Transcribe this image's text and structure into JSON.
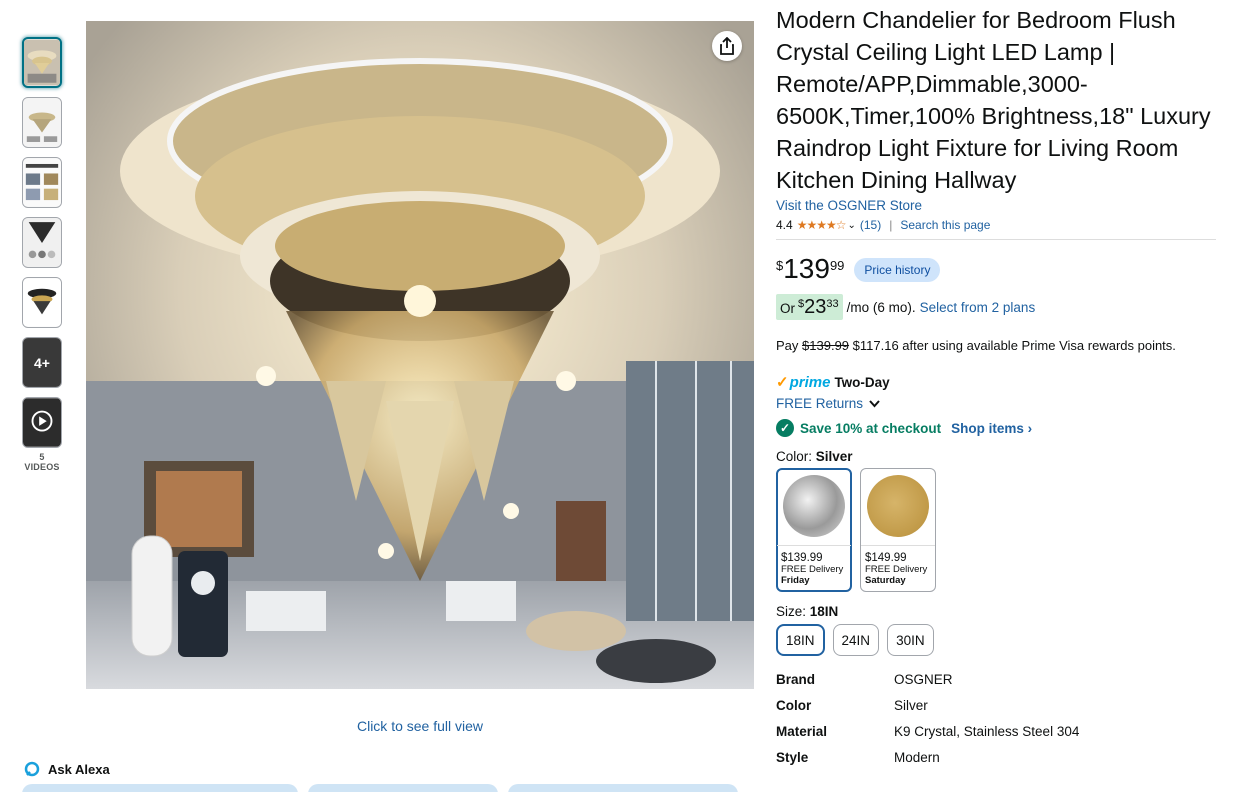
{
  "thumbnails": {
    "items": [
      {
        "name": "thumb-chandelier-main",
        "selected": true
      },
      {
        "name": "thumb-dimensions"
      },
      {
        "name": "thumb-features"
      },
      {
        "name": "thumb-crystal-detail"
      },
      {
        "name": "thumb-chandelier-dark"
      },
      {
        "name": "thumb-more",
        "overlay": "4+"
      },
      {
        "name": "thumb-video"
      }
    ],
    "videos_label": "5 VIDEOS"
  },
  "main_image": {
    "click_full_view": "Click to see full view"
  },
  "alexa": {
    "label": "Ask Alexa"
  },
  "product": {
    "title": "Modern Chandelier for Bedroom Flush Crystal Ceiling Light LED Lamp | Remote/APP,Dimmable,3000-6500K,Timer,100% Brightness,18\" Luxury Raindrop Light Fixture for Living Room Kitchen Dining Hallway",
    "store_link": "Visit the OSGNER Store",
    "rating": "4.4",
    "stars": "★★★★☆",
    "review_count": "(15)",
    "separator": "|",
    "search_page": "Search this page"
  },
  "price": {
    "symbol": "$",
    "whole": "139",
    "fraction": "99",
    "history_label": "Price history"
  },
  "monthly": {
    "or": "Or",
    "symbol": "$",
    "whole": "23",
    "fraction": "33",
    "per": "/mo (6 mo).",
    "select_plans": "Select from 2 plans"
  },
  "prime_offer": {
    "pay": "Pay",
    "old_price": "$139.99",
    "rest": "$117.16 after using available Prime Visa rewards points."
  },
  "delivery": {
    "check": "✓",
    "prime": "prime",
    "two_day": "Two-Day",
    "free_returns": "FREE Returns"
  },
  "savings": {
    "text": "Save 10% at checkout",
    "shop_items": "Shop items ›"
  },
  "color": {
    "label": "Color:",
    "selected": "Silver",
    "options": [
      {
        "price": "$139.99",
        "delivery": "FREE Delivery",
        "day": "Friday",
        "fill": "#b9b9b9"
      },
      {
        "price": "$149.99",
        "delivery": "FREE Delivery",
        "day": "Saturday",
        "fill": "#c9a552"
      }
    ]
  },
  "size": {
    "label": "Size:",
    "selected": "18IN",
    "options": [
      "18IN",
      "24IN",
      "30IN"
    ]
  },
  "specs": [
    {
      "key": "Brand",
      "value": "OSGNER"
    },
    {
      "key": "Color",
      "value": "Silver"
    },
    {
      "key": "Material",
      "value": "K9 Crystal, Stainless Steel 304"
    },
    {
      "key": "Style",
      "value": "Modern"
    }
  ],
  "colors": {
    "link": "#2162a1",
    "green": "#067d62",
    "star": "#de7921",
    "prime_blue": "#00a8e1"
  }
}
